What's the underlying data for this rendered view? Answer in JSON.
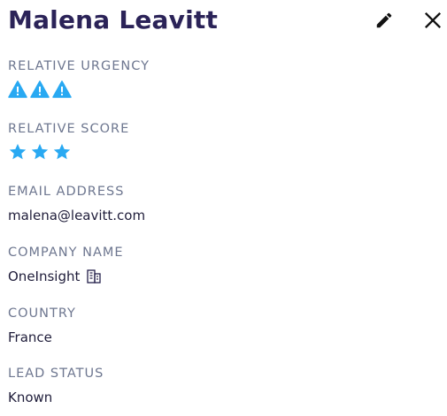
{
  "contact": {
    "name": "Malena Leavitt"
  },
  "toolbar": {
    "edit_icon": "pencil-icon",
    "close_icon": "close-icon"
  },
  "fields": {
    "urgency": {
      "label": "RELATIVE URGENCY",
      "level": 3,
      "icon": "warning-triangle-icon"
    },
    "score": {
      "label": "RELATIVE SCORE",
      "level": 3,
      "icon": "star-icon"
    },
    "email": {
      "label": "EMAIL ADDRESS",
      "value": "malena@leavitt.com"
    },
    "company": {
      "label": "COMPANY NAME",
      "value": "OneInsight",
      "icon": "building-icon"
    },
    "country": {
      "label": "COUNTRY",
      "value": "France"
    },
    "lead_status": {
      "label": "LEAD STATUS",
      "value": "Known"
    }
  },
  "colors": {
    "title": "#2b2358",
    "label": "#6e7790",
    "value": "#1f1d3a",
    "accent": "#29a9f2"
  }
}
